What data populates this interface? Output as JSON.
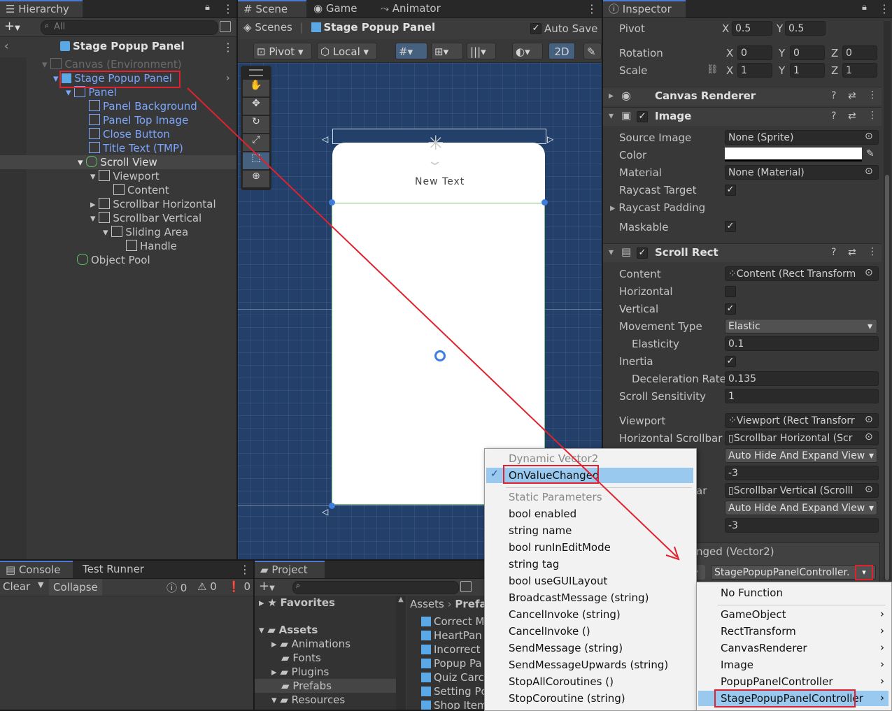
{
  "hierarchy": {
    "tab": "Hierarchy",
    "search_placeholder": "All",
    "scene_title": "Stage Popup Panel",
    "items": [
      {
        "label": "Canvas (Environment)"
      },
      {
        "label": "Stage Popup Panel"
      },
      {
        "label": "Panel"
      },
      {
        "label": "Panel Background"
      },
      {
        "label": "Panel Top Image"
      },
      {
        "label": "Close Button"
      },
      {
        "label": "Title Text (TMP)"
      },
      {
        "label": "Scroll View"
      },
      {
        "label": "Viewport"
      },
      {
        "label": "Content"
      },
      {
        "label": "Scrollbar Horizontal"
      },
      {
        "label": "Scrollbar Vertical"
      },
      {
        "label": "Sliding Area"
      },
      {
        "label": "Handle"
      },
      {
        "label": "Object Pool"
      }
    ]
  },
  "scene": {
    "tabs": [
      "Scene",
      "Game",
      "Animator"
    ],
    "breadcrumb_root": "Scenes",
    "breadcrumb_current": "Stage Popup Panel",
    "auto_save": "Auto Save",
    "pivot": "Pivot",
    "local": "Local",
    "mode_2d": "2D",
    "new_text": "New Text"
  },
  "inspector": {
    "tab": "Inspector",
    "pivot_label": "Pivot",
    "pivot_x": "0.5",
    "pivot_y": "0.5",
    "rotation_label": "Rotation",
    "rotation": [
      "0",
      "0",
      "0"
    ],
    "scale_label": "Scale",
    "scale": [
      "1",
      "1",
      "1"
    ],
    "axis": [
      "X",
      "Y",
      "Z"
    ],
    "canvas_renderer": "Canvas Renderer",
    "image": {
      "title": "Image",
      "source_image_label": "Source Image",
      "source_image": "None (Sprite)",
      "color_label": "Color",
      "color_value": "#ffffff",
      "material_label": "Material",
      "material": "None (Material)",
      "raycast_target_label": "Raycast Target",
      "raycast_padding_label": "Raycast Padding",
      "maskable_label": "Maskable"
    },
    "scroll_rect": {
      "title": "Scroll Rect",
      "content_label": "Content",
      "content": "Content (Rect Transform",
      "horizontal_label": "Horizontal",
      "vertical_label": "Vertical",
      "movement_type_label": "Movement Type",
      "movement_type": "Elastic",
      "elasticity_label": "Elasticity",
      "elasticity": "0.1",
      "inertia_label": "Inertia",
      "deceleration_label": "Deceleration Rate",
      "deceleration": "0.135",
      "scroll_sensitivity_label": "Scroll Sensitivity",
      "scroll_sensitivity": "1",
      "viewport_label": "Viewport",
      "viewport": "Viewport (Rect Transforr",
      "h_scrollbar_label": "Horizontal Scrollbar",
      "h_scrollbar": "Scrollbar Horizontal (Scr",
      "h_visibility": "Auto Hide And Expand View",
      "h_spacing": "-3",
      "v_scrollbar_label_tail": "ar",
      "v_scrollbar": "Scrollbar Vertical (Scrolll",
      "v_visibility": "Auto Hide And Expand View",
      "v_spacing": "-3",
      "event_label_tail": "nged (Vector2)",
      "function_dropdown": "StagePopupPanelController."
    }
  },
  "console": {
    "tabs": [
      "Console",
      "Test Runner"
    ],
    "clear": "Clear",
    "collapse": "Collapse",
    "counts": [
      "0",
      "0",
      "0"
    ]
  },
  "project": {
    "tab": "Project",
    "favorites": "Favorites",
    "assets": "Assets",
    "folders": [
      "Animations",
      "Fonts",
      "Plugins",
      "Prefabs",
      "Resources"
    ],
    "breadcrumb": [
      "Assets",
      "Prefa"
    ],
    "files": [
      "Correct M",
      "HeartPan",
      "Incorrect",
      "Popup Pa",
      "Quiz Carc",
      "Setting Pc",
      "Shop Item"
    ]
  },
  "function_menu": {
    "dynamic_header": "Dynamic Vector2",
    "selected": "OnValueChanged",
    "static_header": "Static Parameters",
    "items": [
      "bool enabled",
      "string name",
      "bool runInEditMode",
      "string tag",
      "bool useGUILayout",
      "BroadcastMessage (string)",
      "CancelInvoke (string)",
      "CancelInvoke ()",
      "SendMessage (string)",
      "SendMessageUpwards (string)",
      "StopAllCoroutines ()",
      "StopCoroutine (string)"
    ]
  },
  "component_menu": {
    "items": [
      "No Function",
      "GameObject",
      "RectTransform",
      "CanvasRenderer",
      "Image",
      "PopupPanelController",
      "StagePopupPanelController"
    ]
  },
  "colors": {
    "highlight_red": "#e0222e",
    "selection_blue": "#99c9ef",
    "scene_bg": "#203a5e"
  }
}
